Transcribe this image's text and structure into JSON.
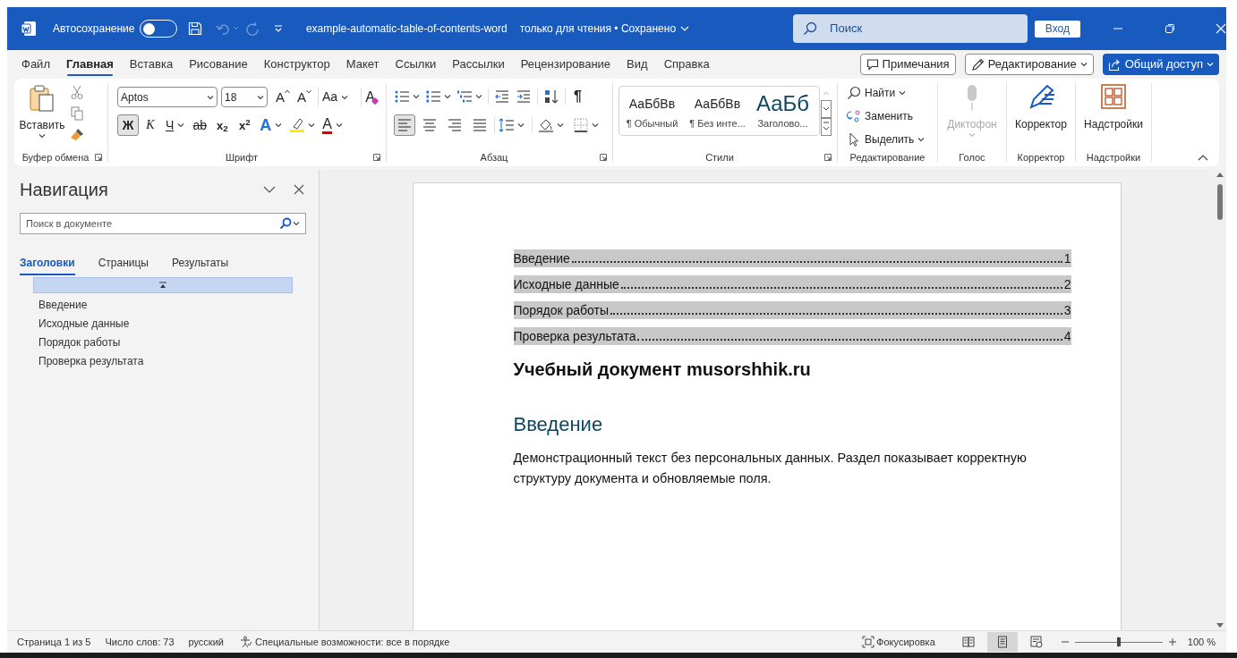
{
  "title_bar": {
    "autosave": {
      "label": "Автосохранение",
      "on": false
    },
    "file_name": "example-automatic-table-of-contents-word",
    "file_status": "только для чтения • Сохранено",
    "search_placeholder": "Поиск",
    "sign_in": "Вход"
  },
  "menu_tabs": [
    {
      "label": "Файл",
      "selected": false
    },
    {
      "label": "Главная",
      "selected": true
    },
    {
      "label": "Вставка",
      "selected": false
    },
    {
      "label": "Рисование",
      "selected": false
    },
    {
      "label": "Конструктор",
      "selected": false
    },
    {
      "label": "Макет",
      "selected": false
    },
    {
      "label": "Ссылки",
      "selected": false
    },
    {
      "label": "Рассылки",
      "selected": false
    },
    {
      "label": "Рецензирование",
      "selected": false
    },
    {
      "label": "Вид",
      "selected": false
    },
    {
      "label": "Справка",
      "selected": false
    }
  ],
  "actions": [
    {
      "kind": "comments",
      "label": "Примечания"
    },
    {
      "kind": "editing",
      "label": "Редактирование"
    },
    {
      "kind": "share",
      "label": "Общий доступ"
    }
  ],
  "ribbon": {
    "clipboard": {
      "paste": "Вставить",
      "label": "Буфер обмена"
    },
    "font": {
      "font_name": "Aptos",
      "font_size": "18",
      "size_tools": [
        {
          "kind": "grow",
          "glyph": "A"
        },
        {
          "kind": "shrink",
          "glyph": "A"
        },
        {
          "kind": "case",
          "glyph": "Aa"
        },
        {
          "kind": "clear",
          "glyph": "A"
        }
      ],
      "format_tools": [
        {
          "kind": "bold",
          "glyph": "Ж",
          "on": true
        },
        {
          "kind": "italic",
          "glyph": "К",
          "on": false
        },
        {
          "kind": "underline",
          "glyph": "Ч",
          "on": false
        },
        {
          "kind": "strike",
          "glyph": "ab",
          "on": false
        },
        {
          "kind": "subscript",
          "glyph": "x$_{2}$",
          "on": false
        },
        {
          "kind": "superscript",
          "glyph": "x$^{2}$",
          "on": false
        },
        {
          "kind": "effects",
          "glyph": "A",
          "on": false
        },
        {
          "kind": "highlight",
          "on": false
        },
        {
          "kind": "color",
          "glyph": "A",
          "on": false
        }
      ],
      "label": "Шрифт"
    },
    "paragraph": {
      "pilcrow": "¶",
      "alignments": [
        {
          "kind": "left",
          "selected": true
        },
        {
          "kind": "center",
          "selected": false
        },
        {
          "kind": "right",
          "selected": false
        },
        {
          "kind": "justify",
          "selected": false
        }
      ],
      "label": "Абзац"
    },
    "styles": {
      "items": [
        {
          "kind": "normal",
          "preview": "АаБбВв",
          "name": "¶ Обычный"
        },
        {
          "kind": "normal",
          "preview": "АаБбВв",
          "name": "¶ Без инте..."
        },
        {
          "kind": "heading",
          "preview": "АаБб",
          "name": "Заголово..."
        }
      ],
      "label": "Стили"
    },
    "editing": {
      "items": [
        {
          "kind": "find",
          "label": "Найти"
        },
        {
          "kind": "replace",
          "label": "Заменить"
        },
        {
          "kind": "select",
          "label": "Выделить"
        }
      ],
      "label": "Редактирование"
    },
    "voice": {
      "button": "Диктофон",
      "disabled": true,
      "label": "Голос"
    },
    "corrector": {
      "button": "Корректор",
      "label": "Корректор"
    },
    "addins": {
      "button": "Надстройки",
      "label": "Надстройки"
    }
  },
  "navigation": {
    "title": "Навигация",
    "search_placeholder": "Поиск в документе",
    "tabs": [
      {
        "label": "Заголовки",
        "selected": true
      },
      {
        "label": "Страницы",
        "selected": false
      },
      {
        "label": "Результаты",
        "selected": false
      }
    ],
    "headings": [
      {
        "label": "Введение"
      },
      {
        "label": "Исходные данные"
      },
      {
        "label": "Порядок работы"
      },
      {
        "label": "Проверка результата"
      }
    ]
  },
  "document": {
    "toc": [
      {
        "title": "Введение",
        "page": "1"
      },
      {
        "title": "Исходные данные",
        "page": "2"
      },
      {
        "title": "Порядок работы",
        "page": "3"
      },
      {
        "title": "Проверка результата",
        "page": "4"
      }
    ],
    "title": "Учебный документ musorshhik.ru",
    "heading": "Введение",
    "paragraph": "Демонстрационный текст без персональных данных. Раздел показывает корректную структуру документа и обновляемые поля."
  },
  "status_bar": {
    "page": "Страница 1 из 5",
    "words": "Число слов: 73",
    "language": "русский",
    "accessibility": "Специальные возможности: все в порядке",
    "focus": "Фокусировка",
    "views": [
      {
        "kind": "read",
        "selected": false
      },
      {
        "kind": "print",
        "selected": true
      },
      {
        "kind": "web",
        "selected": false
      }
    ],
    "zoom": {
      "level": 0.5,
      "reading": "100 %"
    }
  }
}
